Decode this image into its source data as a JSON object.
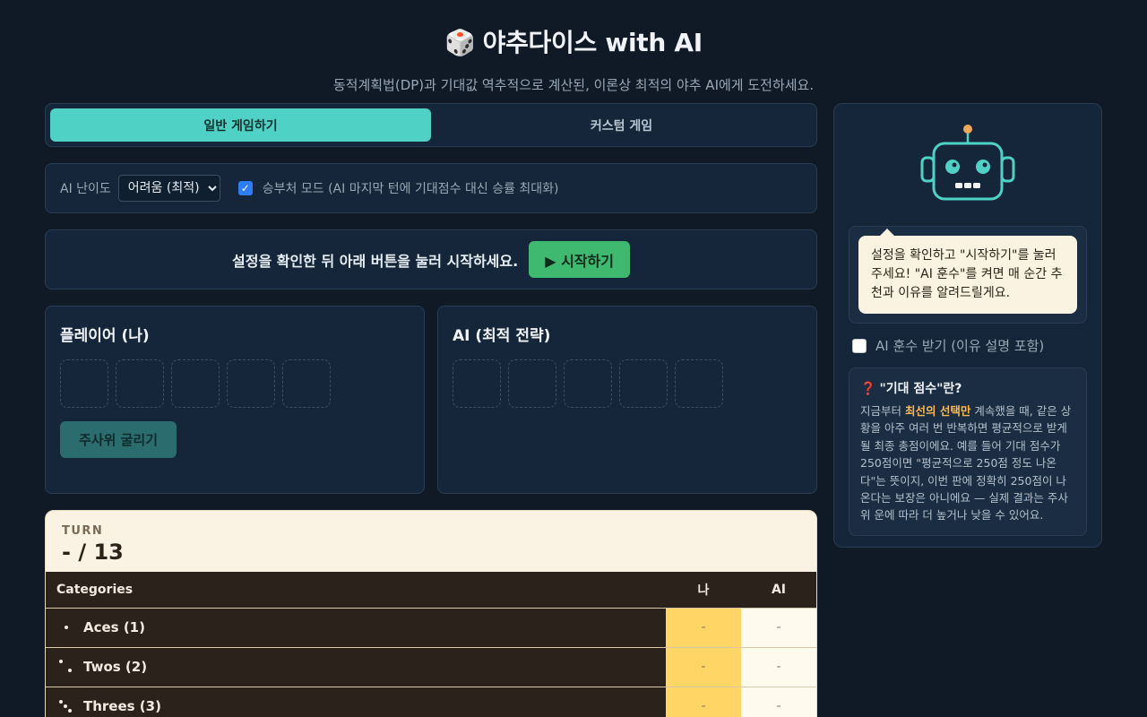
{
  "header": {
    "die_icon": "🎲",
    "title": "야추다이스 with AI",
    "subtitle": "동적계획법(DP)과 기대값 역추적으로 계산된, 이론상 최적의 야추 AI에게 도전하세요."
  },
  "tabs": [
    {
      "label": "일반 게임하기",
      "active": true
    },
    {
      "label": "커스텀 게임",
      "active": false
    }
  ],
  "settings": {
    "difficulty_label": "AI 난이도",
    "difficulty_value": "어려움 (최적)",
    "win_mode_checked": true,
    "win_mode_label": "승부처 모드 (AI 마지막 턴에 기대점수 대신 승률 최대화)"
  },
  "start": {
    "message": "설정을 확인한 뒤 아래 버튼을 눌러 시작하세요.",
    "button_label": "▶ 시작하기"
  },
  "players": {
    "me_title": "플레이어 (나)",
    "ai_title": "AI (최적 전략)",
    "roll_button": "주사위 굴리기"
  },
  "scoreboard": {
    "turn_label": "TURN",
    "turn_value": "- / 13",
    "col_categories": "Categories",
    "col_me": "나",
    "col_ai": "AI",
    "rows": [
      {
        "name": "Aces (1)",
        "me": "-",
        "ai": "-"
      },
      {
        "name": "Twos (2)",
        "me": "-",
        "ai": "-"
      },
      {
        "name": "Threes (3)",
        "me": "-",
        "ai": "-"
      }
    ]
  },
  "assistant": {
    "bubble": "설정을 확인하고 \"시작하기\"를 눌러주세요! \"AI 훈수\"를 켜면 매 순간 추천과 이유를 알려드릴게요.",
    "hint_label": "AI 훈수 받기 (이유 설명 포함)",
    "info_title": "\"기대 점수\"란?",
    "info_pre": "지금부터 ",
    "info_bold": "최선의 선택만",
    "info_post": " 계속했을 때, 같은 상황을 아주 여러 번 반복하면 평균적으로 받게 될 최종 총점이에요. 예를 들어 기대 점수가 250점이면 \"평균적으로 250점 정도 나온다\"는 뜻이지, 이번 판에 정확히 250점이 나온다는 보장은 아니에요 — 실제 결과는 주사위 운에 따라 더 높거나 낮을 수 있어요."
  },
  "colors": {
    "accent_teal": "#4fd1c5",
    "start_green": "#3fb96f",
    "me_column": "#ffd566",
    "background": "#0f1a26"
  }
}
